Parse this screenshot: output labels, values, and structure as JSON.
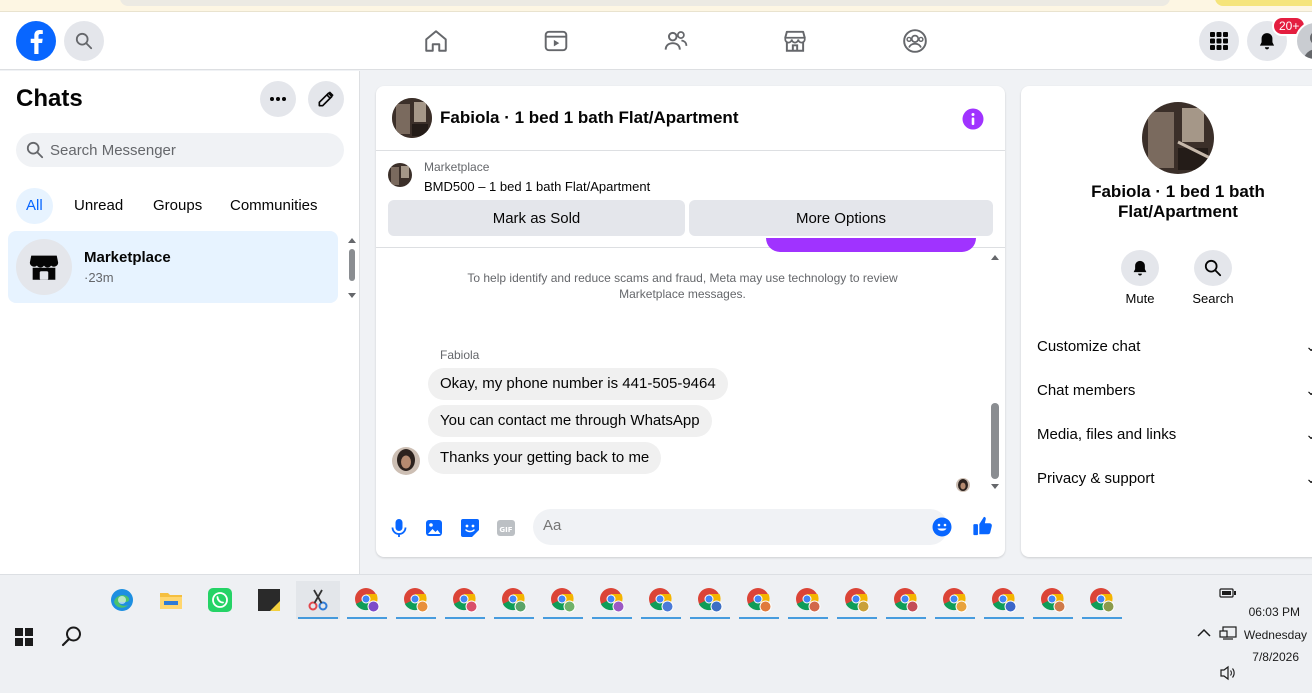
{
  "header": {
    "notifications_badge": "20+"
  },
  "left": {
    "title": "Chats",
    "search_placeholder": "Search Messenger",
    "filters": [
      "All",
      "Unread",
      "Groups",
      "Communities"
    ],
    "chat_item": {
      "name": "Marketplace",
      "meta": "·23m"
    }
  },
  "conversation": {
    "title": "Fabiola · 1 bed 1 bath Flat/Apartment",
    "listing": {
      "source": "Marketplace",
      "item": "BMD500 – 1 bed 1 bath Flat/Apartment"
    },
    "buttons": {
      "mark_sold": "Mark as Sold",
      "more_options": "More Options"
    },
    "notice": "To help identify and reduce scams and fraud, Meta may use technology to review Marketplace messages.",
    "sender": "Fabiola",
    "messages": [
      "Okay, my phone number is 441-505-9464",
      "You can contact me through WhatsApp",
      "Thanks your getting back to me"
    ],
    "composer_placeholder": "Aa"
  },
  "info": {
    "title": "Fabiola · 1 bed 1 bath Flat/Apartment",
    "actions": {
      "mute": "Mute",
      "search": "Search"
    },
    "sections": [
      "Customize chat",
      "Chat members",
      "Media, files and links",
      "Privacy & support"
    ]
  },
  "taskbar": {
    "time": "06:03 PM",
    "day": "Wednesday",
    "date": "7/8/2026"
  },
  "colors": {
    "brand": "#0866ff",
    "accent_purple": "#a033ff",
    "selected_chat_bg": "#e7f3ff"
  }
}
